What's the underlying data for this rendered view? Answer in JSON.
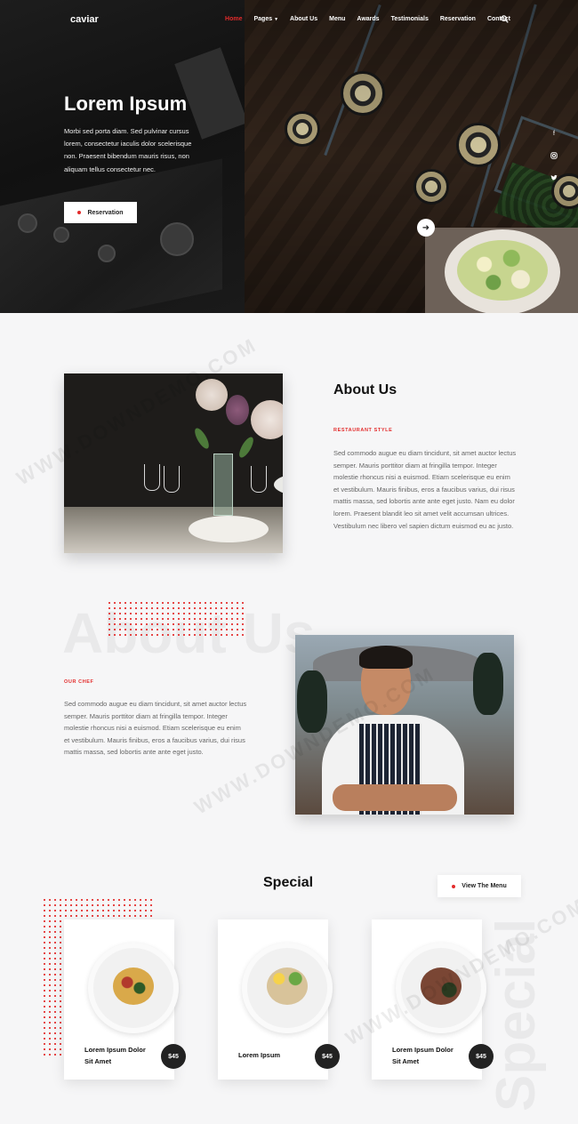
{
  "header": {
    "logo": "caviar",
    "nav": [
      {
        "label": "Home",
        "active": true
      },
      {
        "label": "Pages",
        "dropdown": true
      },
      {
        "label": "About Us"
      },
      {
        "label": "Menu"
      },
      {
        "label": "Awards"
      },
      {
        "label": "Testimonials"
      },
      {
        "label": "Reservation"
      },
      {
        "label": "Contact"
      }
    ],
    "search_icon": "search-icon"
  },
  "hero": {
    "title": "Lorem Ipsum",
    "text": "Morbi sed porta diam. Sed pulvinar cursus lorem, consectetur iaculis dolor scelerisque non. Praesent bibendum mauris risus, non aliquam tellus consectetur nec.",
    "button": "Reservation",
    "social": [
      "facebook-icon",
      "instagram-icon",
      "twitter-icon"
    ],
    "next_icon": "arrow-right-icon"
  },
  "about": {
    "title": "About Us",
    "kicker": "RESTAURANT STYLE",
    "text": "Sed commodo augue eu diam tincidunt, sit amet auctor lectus semper. Mauris porttitor diam at fringilla tempor. Integer molestie rhoncus nisi a euismod. Etiam scelerisque eu enim et vestibulum. Mauris finibus, eros a faucibus varius, dui risus mattis massa, sed lobortis ante ante eget justo. Nam eu dolor lorem. Praesent blandit leo sit amet velit accumsan ultrices. Vestibulum nec libero vel sapien dictum euismod eu ac justo."
  },
  "chef": {
    "watermark": "About Us",
    "kicker": "OUR CHEF",
    "text": "Sed commodo augue eu diam tincidunt, sit amet auctor lectus semper. Mauris porttitor diam at fringilla tempor. Integer molestie rhoncus nisi a euismod. Etiam scelerisque eu enim et vestibulum. Mauris finibus, eros a faucibus varius, dui risus mattis massa, sed lobortis ante ante eget justo."
  },
  "special": {
    "title": "Special",
    "watermark": "Special",
    "button": "View The Menu",
    "items": [
      {
        "name": "Lorem Ipsum Dolor Sit Amet",
        "price": "$45"
      },
      {
        "name": "Lorem Ipsum",
        "price": "$45"
      },
      {
        "name": "Lorem Ipsum Dolor Sit Amet",
        "price": "$45"
      }
    ]
  },
  "site_watermark": "WWW.DOWNDEMO.COM",
  "colors": {
    "accent": "#e32b2b",
    "dark": "#222222",
    "background": "#f6f6f7"
  }
}
